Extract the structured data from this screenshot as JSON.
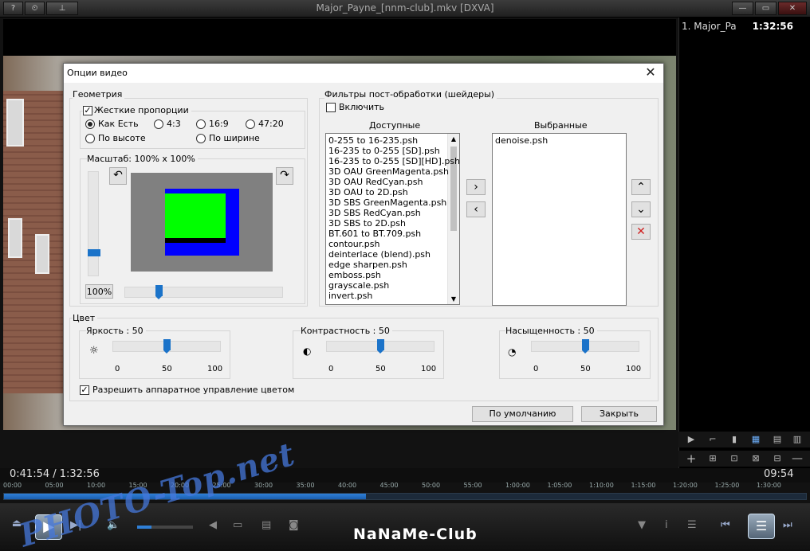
{
  "window": {
    "title": "Major_Payne_[nnm-club].mkv [DXVA]",
    "left_buttons": [
      "?",
      "⏲",
      "⊥"
    ],
    "right_buttons": [
      "—",
      "▭",
      "✕"
    ]
  },
  "playlist": {
    "item_name": "1. Major_Pa",
    "item_duration": "1:32:56",
    "toolbar1": [
      "▶",
      "⌐",
      "▮",
      "▦",
      "▤",
      "▥"
    ],
    "toolbar2": [
      "+",
      "⊞",
      "⊡",
      "⊠",
      "⊟",
      "—"
    ]
  },
  "timeline": {
    "current": "0:41:54 / 1:32:56",
    "remaining": "09:54",
    "ticks": [
      "00:00",
      "05:00",
      "10:00",
      "15:00",
      "20:00",
      "25:00",
      "30:00",
      "35:00",
      "40:00",
      "45:00",
      "50:00",
      "55:00",
      "1:00:00",
      "1:05:00",
      "1:10:00",
      "1:15:00",
      "1:20:00",
      "1:25:00",
      "1:30:00"
    ],
    "progress": 0.451
  },
  "watermarks": {
    "site": "PHOTO-Top.net",
    "club": "NaNaMe-Club"
  },
  "dialog": {
    "title": "Опции видео",
    "close": "✕",
    "geometry": {
      "label": "Геометрия",
      "fixed_ratio": {
        "label": "Жесткие пропорции",
        "checked": true
      },
      "ratios": [
        {
          "label": "Как Есть",
          "selected": true
        },
        {
          "label": "4:3",
          "selected": false
        },
        {
          "label": "16:9",
          "selected": false
        },
        {
          "label": "47:20",
          "selected": false
        },
        {
          "label": "По высоте",
          "selected": false
        },
        {
          "label": "По ширине",
          "selected": false
        }
      ],
      "scale_label": "Масштаб: 100% x 100%",
      "reset_label": "100%",
      "rotate_left": "↶",
      "rotate_right": "↷"
    },
    "shaders": {
      "label": "Фильтры пост-обработки (шейдеры)",
      "enable": {
        "label": "Включить",
        "checked": false
      },
      "available_label": "Доступные",
      "selected_label": "Выбранные",
      "available": [
        "0-255 to 16-235.psh",
        "16-235 to 0-255 [SD].psh",
        "16-235 to 0-255 [SD][HD].psh",
        "3D OAU GreenMagenta.psh",
        "3D OAU RedCyan.psh",
        "3D OAU to 2D.psh",
        "3D SBS GreenMagenta.psh",
        "3D SBS RedCyan.psh",
        "3D SBS to 2D.psh",
        "BT.601 to BT.709.psh",
        "contour.psh",
        "deinterlace (blend).psh",
        "edge sharpen.psh",
        "emboss.psh",
        "grayscale.psh",
        "invert.psh"
      ],
      "selected": [
        "denoise.psh"
      ],
      "add": "›",
      "remove": "‹",
      "up": "⌃",
      "down": "⌄",
      "delete": "✕"
    },
    "color": {
      "label": "Цвет",
      "brightness": {
        "label": "Яркость : 50",
        "value": 50,
        "icon": "sun-icon"
      },
      "contrast": {
        "label": "Контрастность : 50",
        "value": 50,
        "icon": "contrast-icon"
      },
      "saturation": {
        "label": "Насыщенность : 50",
        "value": 50,
        "icon": "saturation-icon"
      },
      "scale": [
        "0",
        "50",
        "100"
      ],
      "hw_control": {
        "label": "Разрешить аппаратное управление цветом",
        "checked": true
      }
    },
    "buttons": {
      "default": "По умолчанию",
      "close": "Закрыть"
    }
  },
  "colors": {
    "accent": "#1b73c9",
    "preview_green": "#00ff00",
    "preview_blue": "#0000ff",
    "preview_gray": "#808080"
  }
}
